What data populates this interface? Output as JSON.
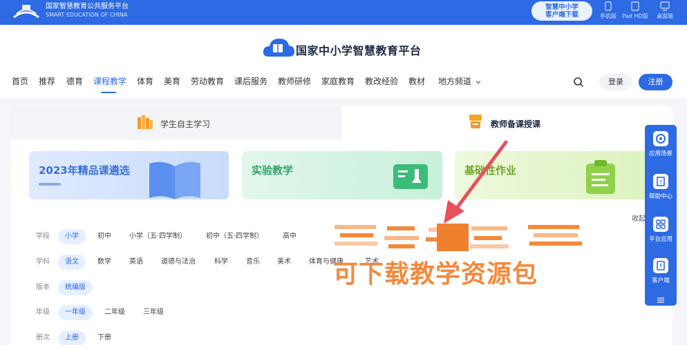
{
  "topbar": {
    "title": "国家智慧教育公共服务平台",
    "subtitle": "SMART EDUCATION OF CHINA",
    "download_line1": "智慧中小学",
    "download_line2": "客户端下载",
    "devices": [
      "手机版",
      "Pad HD版",
      "桌面端"
    ]
  },
  "header": {
    "brand": "国家中小学智慧教育平台",
    "nav": [
      "首页",
      "推荐",
      "德育",
      "课程教学",
      "体育",
      "美育",
      "劳动教育",
      "课后服务",
      "教师研修",
      "家庭教育",
      "教改经验",
      "教材",
      "地方频道"
    ],
    "nav_active": "课程教学",
    "login": "登录",
    "register": "注册"
  },
  "tabs": {
    "left": "学生自主学习",
    "right": "教师备课授课"
  },
  "banners": [
    "2023年精品课遴选",
    "实验教学",
    "基础性作业"
  ],
  "filters": {
    "collapse": "收起",
    "rows": [
      {
        "label": "学段",
        "options": [
          "小学",
          "初中",
          "小学（五·四学制）",
          "初中（五·四学制）",
          "高中"
        ]
      },
      {
        "label": "学科",
        "options": [
          "语文",
          "数学",
          "英语",
          "道德与法治",
          "科学",
          "音乐",
          "美术",
          "体育与健康",
          "艺术"
        ]
      },
      {
        "label": "版本",
        "options": [
          "统编版"
        ]
      },
      {
        "label": "年级",
        "options": [
          "一年级",
          "二年级",
          "三年级"
        ]
      },
      {
        "label": "册次",
        "options": [
          "上册",
          "下册"
        ]
      }
    ]
  },
  "side_panel": [
    "应用场景",
    "帮助中心",
    "平台应用",
    "客户端"
  ],
  "overlay": {
    "text": "可下载教学资源包"
  },
  "colors": {
    "primary": "#2d6ae3",
    "overlay": "#f5893b"
  }
}
